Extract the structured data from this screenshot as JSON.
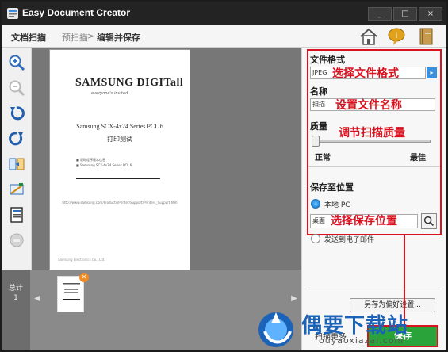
{
  "window": {
    "title": "Easy Document Creator",
    "controls": [
      "_",
      "□",
      "×"
    ]
  },
  "toolbar": {
    "breadcrumb": [
      "文档扫描",
      "预扫描",
      ">",
      "编辑并保存"
    ],
    "icons": [
      "home-icon",
      "help-bubble-icon",
      "book-icon"
    ]
  },
  "left_tools": [
    "zoom-in-icon",
    "zoom-out-icon",
    "rotate-left-icon",
    "rotate-right-icon",
    "flip-icon",
    "crop-icon",
    "fit-page-icon",
    "disabled-tool-icon"
  ],
  "document": {
    "logo": "SAMSUNG DIGITall",
    "logo_sub": "everyone's invited.",
    "title": "Samsung SCX-4x24 Series PCL 6",
    "subtitle": "打印测试",
    "bullets": [
      "驱动程序版本信息",
      "Samsung SCX-4x24 Series PCL 6"
    ],
    "url": "http://www.samsung.com/Products/Printer/Support/Printers_Support.htm",
    "footer": "Samsung Electronics Co., Ltd."
  },
  "panel": {
    "format_label": "文件格式",
    "format_value": "JPEG",
    "format_annotation": "选择文件格式",
    "name_label": "名称",
    "name_value": "扫描",
    "name_annotation": "设置文件名称",
    "quality_label": "质量",
    "quality_annotation": "调节扫描质量",
    "quality_low": "正常",
    "quality_high": "最佳",
    "save_to_label": "保存至位置",
    "local_pc_label": "本地 PC",
    "location_value": "桌面",
    "location_annotation": "选择保存位置",
    "email_label": "发送到电子邮件",
    "save_pref_button": "另存为偏好设置...",
    "scan_more_link": "扫描更多",
    "save_button": "保存"
  },
  "bottom": {
    "total_label": "总计",
    "total_count": "1"
  },
  "watermark": {
    "text": "偶要下载站",
    "url": "ouyaoxiazai.com"
  },
  "colors": {
    "accent_red": "#d9121f",
    "title_bar": "#232323",
    "radio_blue": "#2186d8",
    "save_green": "#2aa43a",
    "watermark_blue": "#1a63b8"
  }
}
